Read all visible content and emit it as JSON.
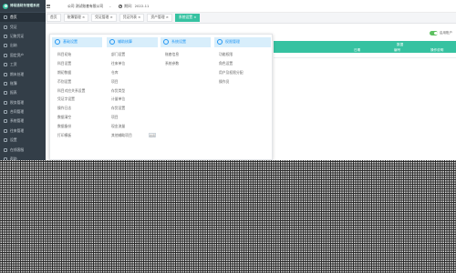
{
  "app": {
    "logo_text": "博易通财务管理系统"
  },
  "sidebar": {
    "items": [
      {
        "label": "首页"
      },
      {
        "label": "凭证"
      },
      {
        "label": "记账凭证"
      },
      {
        "label": "出纳"
      },
      {
        "label": "固定资产"
      },
      {
        "label": "工资"
      },
      {
        "label": "期末处理"
      },
      {
        "label": "账簿"
      },
      {
        "label": "报表"
      },
      {
        "label": "税务管理"
      },
      {
        "label": "合同管理"
      },
      {
        "label": "系统管理"
      },
      {
        "label": "往来管理"
      },
      {
        "label": "设置"
      },
      {
        "label": "在线客服"
      },
      {
        "label": "帮助"
      }
    ]
  },
  "topbar": {
    "company": "公司 测试账套有限公司",
    "period_label": "期间：2022-11"
  },
  "tabs": [
    {
      "label": "首页",
      "active": false
    },
    {
      "label": "账簿管理 ×",
      "active": false
    },
    {
      "label": "凭证管理 ×",
      "active": false
    },
    {
      "label": "凭证列表 ×",
      "active": false
    },
    {
      "label": "资产管理 ×",
      "active": false
    },
    {
      "label": "系统设置 ×",
      "active": true
    }
  ],
  "main": {
    "toggle_label": "启用账户",
    "table_group_header": "数据",
    "table_headers": [
      "日期",
      "编号",
      "操作说明"
    ]
  },
  "menu": {
    "columns": [
      {
        "title": "基础设置",
        "items": [
          "科目初始",
          "科目设置",
          "期初数据",
          "币别设置",
          "科目对应关系设置",
          "凭证字设置",
          "操作日志",
          "数据清空",
          "数据备份",
          "打印模板"
        ]
      },
      {
        "title": "辅助核算",
        "items": [
          "部门设置",
          "往来单位",
          "仓库",
          "项目",
          "存货类型",
          "计量单位",
          "存货设置",
          "项目",
          "现金流量",
          "其他辅助项目"
        ]
      },
      {
        "title": "系统设置",
        "items": [
          "账套信息",
          "系统参数"
        ]
      },
      {
        "title": "权限管理",
        "items": [
          "功能权限",
          "角色设置",
          "用户及权限分配",
          "操作员"
        ]
      }
    ],
    "mini_button": "启用"
  },
  "colors": {
    "accent": "#36c2a1",
    "sidebar_bg": "#333e48",
    "menu_header_bg": "#d8eefb",
    "menu_header_text": "#2196f3"
  }
}
